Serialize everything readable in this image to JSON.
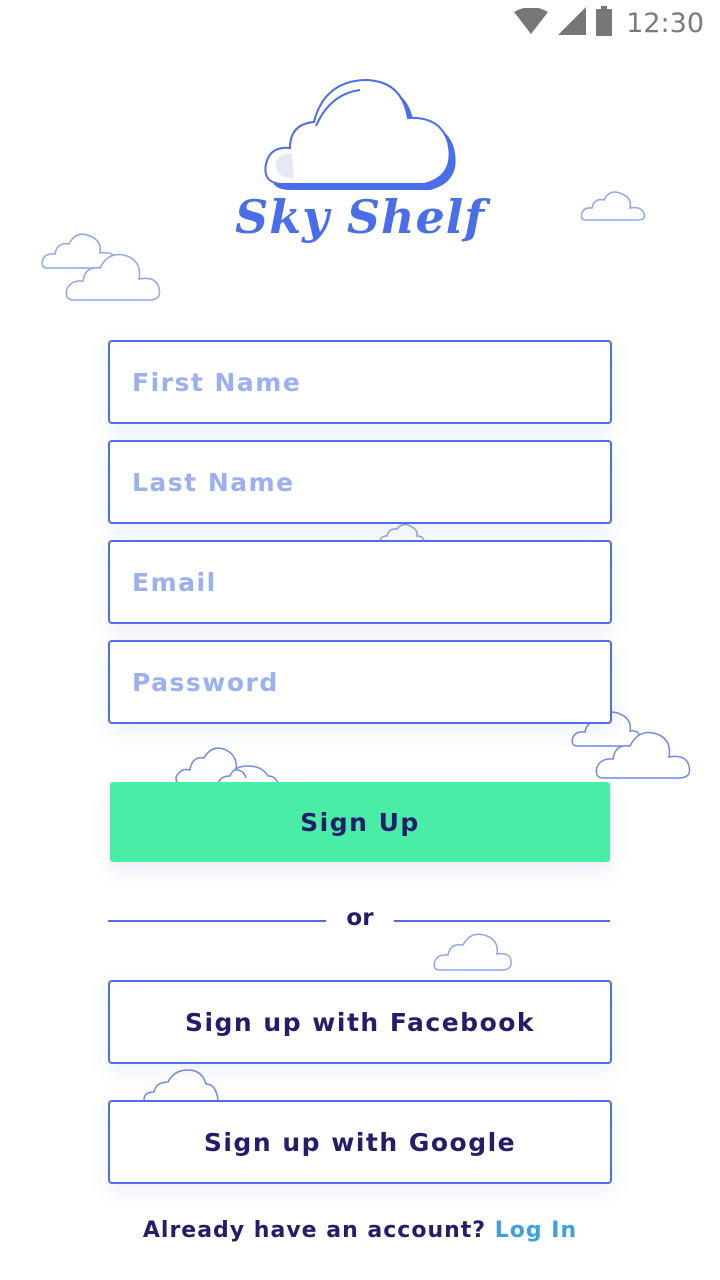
{
  "status_bar": {
    "time": "12:30",
    "icons": [
      "wifi-icon",
      "cell-signal-icon",
      "battery-icon"
    ]
  },
  "app": {
    "name": "Sky Shelf"
  },
  "form": {
    "first_name_placeholder": "First Name",
    "last_name_placeholder": "Last Name",
    "email_placeholder": "Email",
    "password_placeholder": "Password",
    "signup_label": "Sign Up"
  },
  "divider": {
    "label": "or"
  },
  "social": {
    "facebook_label": "Sign up with Facebook",
    "google_label": "Sign up with Google"
  },
  "footer": {
    "prompt": "Already have an account?",
    "login_label": "Log In"
  },
  "colors": {
    "accent": "#4e6ee6",
    "primary_button": "#4aeda6",
    "text_dark": "#241d6b",
    "placeholder": "#9bb0f2",
    "link": "#3fa0e0"
  }
}
